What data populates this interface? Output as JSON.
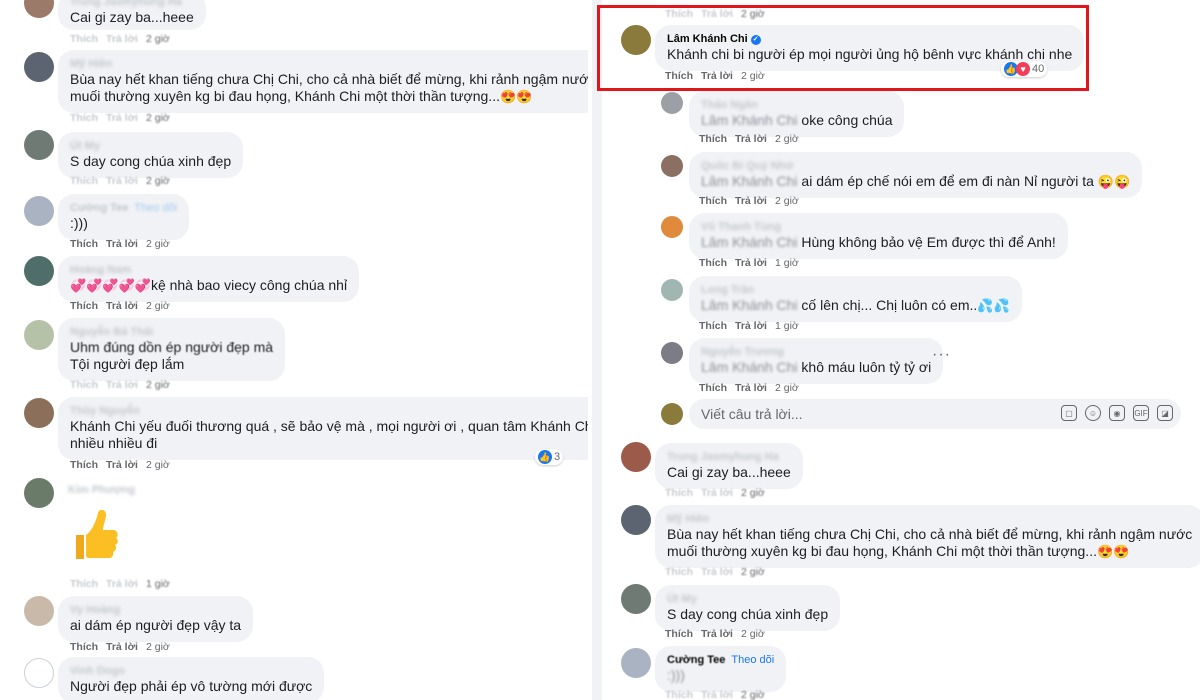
{
  "actions": {
    "like": "Thích",
    "reply": "Trả lời"
  },
  "left": {
    "comments": [
      {
        "name": "Trung Jasmyhung Ha",
        "text": "Cai gi zay ba...heee",
        "time": "2 giờ"
      },
      {
        "name": "Mỹ Hiền",
        "text_line1": "Bùa nay hết khan tiếng chưa Chị Chi, cho cả nhà biết để mừng, khi rảnh ngậm nước",
        "text_line2": "muối thường xuyên kg bi đau họng, Khánh Chi một thời thần tượng...",
        "time": "2 giờ"
      },
      {
        "name": "Út My",
        "text": "S day cong chúa xinh đẹp",
        "time": "2 giờ"
      },
      {
        "name": "Cường Tee",
        "follow": "Theo dõi",
        "text": ":)))",
        "time": "2 giờ"
      },
      {
        "name": "Hoàng Nam",
        "text": "kệ nhà bao viecy công chúa nhỉ",
        "time": "2 giờ"
      },
      {
        "name": "Nguyễn Bá Thái",
        "text_line1": "Uhm đúng dồn ép người đẹp mà",
        "text_line2": "Tội người đẹp lắm",
        "time": "2 giờ"
      },
      {
        "name": "Thùy Nguyễn",
        "text_line1": "Khánh Chi yếu đuối thương quá , sẽ bảo vệ mà , mọi người ơi , quan tâm Khánh Chi",
        "text_line2": "nhiều nhiều đi",
        "time": "2 giờ",
        "reactions": "3"
      },
      {
        "name": "Kim Phượng",
        "time": "1 giờ"
      },
      {
        "name": "Vy Hoàng",
        "text": "ai dám ép người đẹp vậy ta",
        "time": "2 giờ"
      },
      {
        "name": "Vinh Dogo",
        "text": "Người đẹp phải ép vô tường mới được"
      }
    ]
  },
  "right": {
    "top_time": "2 giờ",
    "main": {
      "name": "Lâm Khánh Chi",
      "text": "Khánh chi bi người ép mọi người ủng hộ bênh vực khánh chi nhe",
      "time": "2 giờ",
      "reactions": "40"
    },
    "replies": [
      {
        "name": "Thảo Ngân",
        "tag": "Lâm Khánh Chi",
        "text": "oke công chúa",
        "time": "2 giờ"
      },
      {
        "name": "Quốc Bi Quý Nhứ",
        "tag": "Lâm Khánh Chi",
        "text": "ai dám ép chế nói em để em đi nàn Nỉ người ta",
        "time": "2 giờ"
      },
      {
        "name": "Vũ Thanh Tùng",
        "tag": "Lâm Khánh Chi",
        "text": "Hùng không bảo vệ Em được thì để Anh!",
        "time": "1 giờ"
      },
      {
        "name": "Long Trần",
        "tag": "Lâm Khánh Chi",
        "text": "cố lên chị... Chị luôn có em..",
        "time": "1 giờ"
      },
      {
        "name": "Nguyễn Trương",
        "tag": "Lâm Khánh Chi",
        "text": "khô máu luôn tỷ tỷ ơi",
        "time": "2 giờ"
      }
    ],
    "reply_placeholder": "Viết câu trả lời...",
    "comments": [
      {
        "name": "Trung Jasmyhung Ha",
        "text": "Cai gi zay ba...heee",
        "time": "2 giờ"
      },
      {
        "name": "Mỹ Hiền",
        "text_line1": "Bùa nay hết khan tiếng chưa Chị Chi, cho cả nhà biết để mừng, khi rảnh ngậm nước",
        "text_line2": "muối thường xuyên kg bi đau họng, Khánh Chi một thời thần tượng...",
        "time": "2 giờ"
      },
      {
        "name": "Út My",
        "text": "S day cong chúa xinh đẹp",
        "time": "2 giờ"
      },
      {
        "name": "Cường Tee",
        "follow": "Theo dõi",
        "text": ":)))",
        "time": "2 giờ"
      }
    ]
  }
}
